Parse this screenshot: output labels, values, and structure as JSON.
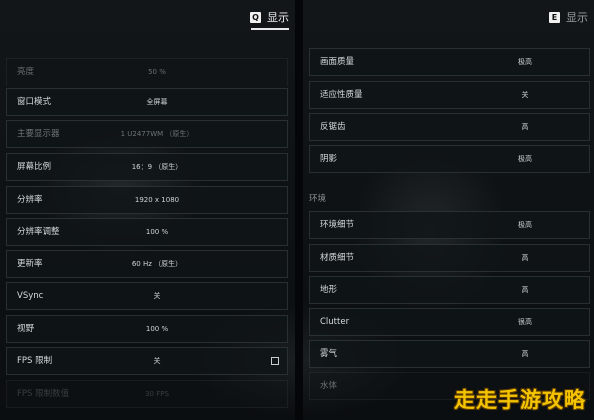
{
  "left_panel": {
    "key_hint": "Q",
    "tab_label": "显示",
    "rows": [
      {
        "label": "亮度",
        "value": "50 %"
      },
      {
        "label": "窗口模式",
        "value": "全屏幕"
      },
      {
        "label": "主要显示器",
        "value": "1 U2477WM （原生）"
      },
      {
        "label": "屏幕比例",
        "value": "16：9 （原生）"
      },
      {
        "label": "分辨率",
        "value": "1920 x 1080"
      },
      {
        "label": "分辨率调整",
        "value": "100 %"
      },
      {
        "label": "更新率",
        "value": "60 Hz （原生）"
      },
      {
        "label": "VSync",
        "value": "关"
      },
      {
        "label": "视野",
        "value": "100 %"
      },
      {
        "label": "FPS 限制",
        "value": "关"
      },
      {
        "label": "FPS 限制数值",
        "value": "30 FPS"
      }
    ]
  },
  "right_panel": {
    "key_hint": "E",
    "tab_label": "显示",
    "rows_top": [
      {
        "label": "画面质量",
        "value": "极高"
      },
      {
        "label": "适应性质量",
        "value": "关"
      },
      {
        "label": "反锯齿",
        "value": "高"
      },
      {
        "label": "阴影",
        "value": "极高"
      }
    ],
    "section_environment": "环境",
    "rows_env": [
      {
        "label": "环境细节",
        "value": "极高"
      },
      {
        "label": "材质细节",
        "value": "高"
      },
      {
        "label": "地形",
        "value": "高"
      },
      {
        "label": "Clutter",
        "value": "很高"
      },
      {
        "label": "雾气",
        "value": "高"
      },
      {
        "label": "水体",
        "value": ""
      }
    ]
  },
  "watermark": "走走手游攻略"
}
